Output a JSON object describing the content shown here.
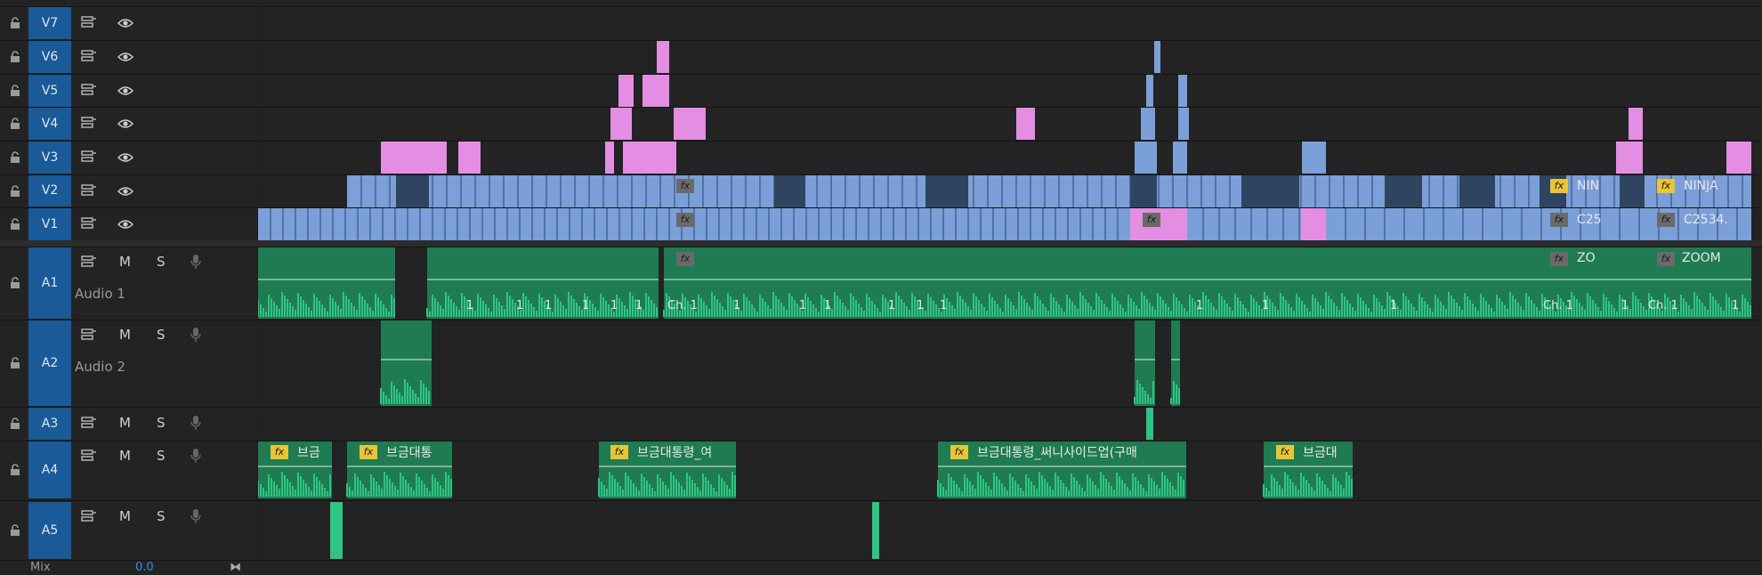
{
  "tracks": {
    "video": [
      {
        "label": "V7"
      },
      {
        "label": "V6"
      },
      {
        "label": "V5"
      },
      {
        "label": "V4"
      },
      {
        "label": "V3"
      },
      {
        "label": "V2"
      },
      {
        "label": "V1"
      }
    ],
    "audio": [
      {
        "label": "A1",
        "name": "Audio 1",
        "m": "M",
        "s": "S"
      },
      {
        "label": "A2",
        "name": "Audio 2",
        "m": "M",
        "s": "S"
      },
      {
        "label": "A3",
        "m": "M",
        "s": "S"
      },
      {
        "label": "A4",
        "m": "M",
        "s": "S"
      },
      {
        "label": "A5",
        "m": "M",
        "s": "S"
      }
    ]
  },
  "clips": {
    "v2_a": "NIN",
    "v2_b": "NINJA",
    "v1_a": "C25",
    "v1_b": "C2534.",
    "a1_a": "ZO",
    "a1_b": "ZOOM",
    "a1_ch1_a": "Ch. 1",
    "a1_ch1_b": "Ch. 1",
    "a1_ch1_c": "Ch. 1",
    "a1_one": "1",
    "a4_1": "브금",
    "a4_2": "브금대통",
    "a4_3": "브금대통령_여",
    "a4_4": "브금대통령_써니사이드업(구매",
    "a4_5": "브금대",
    "fx": "fx"
  },
  "mix": {
    "label": "Mix",
    "value": "0.0"
  },
  "colors": {
    "track_label_bg": "#1a5a99",
    "video_clip": "#7b9fd8",
    "video_clip_dark": "#2e4460",
    "pink_clip": "#e38ee3",
    "audio_clip": "#2fc482",
    "audio_dark": "#1f7b52"
  }
}
